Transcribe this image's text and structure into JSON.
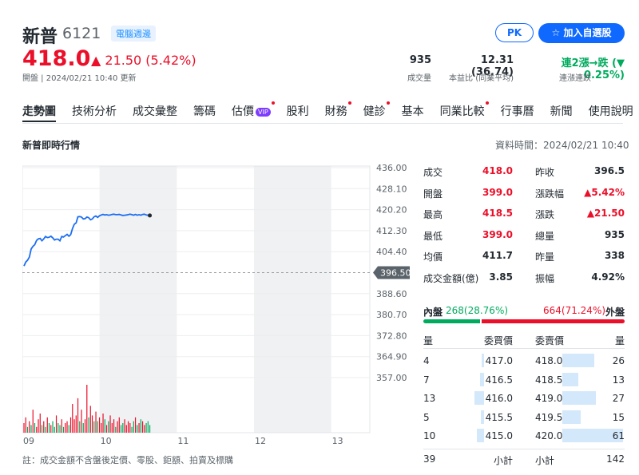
{
  "header": {
    "name": "新普",
    "code": "6121",
    "tag": "電腦週邊",
    "pk_label": "PK",
    "watch_label": "加入自選股",
    "price": "418.0",
    "change": "▲ 21.50 (5.42%)",
    "status": "開盤 | 2024/02/21 10:40 更新",
    "stats": [
      {
        "value": "935",
        "label": "成交量"
      },
      {
        "value": "12.31 (36.74)",
        "label": "本益比 (同業平均)"
      },
      {
        "value": "連2漲→跌 (▼ 0.25%)",
        "label": "連漲連跌"
      }
    ]
  },
  "tabs": [
    {
      "label": "走勢圖",
      "active": true,
      "dot": false
    },
    {
      "label": "技術分析",
      "active": false,
      "dot": false
    },
    {
      "label": "成交彙整",
      "active": false,
      "dot": false
    },
    {
      "label": "籌碼",
      "active": false,
      "dot": false
    },
    {
      "label": "估價",
      "active": false,
      "dot": true,
      "vip": "VIP"
    },
    {
      "label": "股利",
      "active": false,
      "dot": false
    },
    {
      "label": "財務",
      "active": false,
      "dot": true
    },
    {
      "label": "健診",
      "active": false,
      "dot": true
    },
    {
      "label": "基本",
      "active": false,
      "dot": false
    },
    {
      "label": "同業比較",
      "active": false,
      "dot": true
    },
    {
      "label": "行事曆",
      "active": false,
      "dot": false
    },
    {
      "label": "新聞",
      "active": false,
      "dot": false
    },
    {
      "label": "使用說明",
      "active": false,
      "dot": false
    }
  ],
  "section": {
    "title": "新普即時行情",
    "data_time": "資料時間：2024/02/21 10:40"
  },
  "colors": {
    "up": "#eb0f29",
    "down": "#00ab5e",
    "line": "#1c6ef2",
    "accent": "#0f69ff"
  },
  "chart_data": {
    "type": "line",
    "x_ticks": [
      "09",
      "10",
      "11",
      "12",
      "13"
    ],
    "y_ticks": [
      "436.00",
      "428.10",
      "420.20",
      "412.30",
      "404.40",
      "396.50",
      "388.60",
      "380.70",
      "372.80",
      "364.90",
      "357.00"
    ],
    "ylim": [
      357.0,
      436.0
    ],
    "reference_price": "396.50",
    "price_x": [
      0,
      1,
      2,
      3,
      4,
      5,
      6,
      7,
      8,
      9,
      10,
      11,
      12,
      13,
      14,
      15,
      16,
      17,
      18,
      19,
      20,
      21,
      22,
      23,
      24,
      25,
      26,
      27,
      28,
      29,
      30,
      31,
      32,
      33,
      34,
      35,
      36,
      37,
      38,
      39,
      40,
      41,
      42,
      43,
      44,
      45,
      46,
      47,
      48,
      49,
      50,
      51,
      52,
      53,
      54,
      55,
      56,
      57,
      58,
      59,
      60,
      61,
      62,
      63,
      64,
      65,
      66,
      67,
      68,
      69,
      70
    ],
    "price_values": [
      399.0,
      400.5,
      401.2,
      402.4,
      405.4,
      406.4,
      407.0,
      408.6,
      409.2,
      409.4,
      408.5,
      409.2,
      410.1,
      409.7,
      409.8,
      410.2,
      409.6,
      408.8,
      409.1,
      409.1,
      408.5,
      410.1,
      409.9,
      410.4,
      410.9,
      410.2,
      410.8,
      413.1,
      414.7,
      415.2,
      417.5,
      417.6,
      417.4,
      416.7,
      416.8,
      417.4,
      417.2,
      416.4,
      416.7,
      417.5,
      417.8,
      417.3,
      417.9,
      418.2,
      418.4,
      418.2,
      418.3,
      418.1,
      418.2,
      418.4,
      418.5,
      418.3,
      418.3,
      418.4,
      418.2,
      418.0,
      418.1,
      418.2,
      418.3,
      418.5,
      418.3,
      418.1,
      418.4,
      418.1,
      418.3,
      418.1,
      418.4,
      418.5,
      418.2,
      418.1,
      418.0
    ],
    "volume_values": [
      5,
      8,
      3,
      6,
      4,
      12,
      5,
      3,
      7,
      10,
      4,
      6,
      3,
      8,
      5,
      4,
      6,
      3,
      9,
      5,
      4,
      7,
      3,
      5,
      6,
      4,
      8,
      15,
      7,
      9,
      18,
      6,
      12,
      5,
      7,
      25,
      8,
      14,
      9,
      6,
      11,
      6,
      8,
      5,
      10,
      7,
      4,
      6,
      9,
      5,
      7,
      3,
      6,
      8,
      4,
      5,
      7,
      4,
      6,
      5,
      3,
      6,
      8,
      4,
      5,
      7,
      6,
      4,
      5,
      6,
      4
    ],
    "volume_colors": [
      "up",
      "up",
      "down",
      "up",
      "down",
      "up",
      "down",
      "up",
      "up",
      "up",
      "down",
      "up",
      "down",
      "up",
      "down",
      "up",
      "down",
      "down",
      "up",
      "down",
      "down",
      "up",
      "down",
      "up",
      "up",
      "down",
      "up",
      "up",
      "up",
      "up",
      "up",
      "down",
      "up",
      "down",
      "up",
      "up",
      "down",
      "up",
      "up",
      "down",
      "up",
      "down",
      "up",
      "up",
      "up",
      "down",
      "up",
      "down",
      "up",
      "up",
      "up",
      "down",
      "up",
      "up",
      "down",
      "down",
      "up",
      "up",
      "up",
      "up",
      "down",
      "down",
      "up",
      "down",
      "up",
      "down",
      "up",
      "up",
      "down",
      "down",
      "down"
    ]
  },
  "quote": {
    "left": [
      {
        "label": "成交",
        "value": "418.0",
        "color": "up"
      },
      {
        "label": "開盤",
        "value": "399.0",
        "color": "up"
      },
      {
        "label": "最高",
        "value": "418.5",
        "color": "up"
      },
      {
        "label": "最低",
        "value": "399.0",
        "color": "up"
      },
      {
        "label": "均價",
        "value": "411.7",
        "color": "flat"
      },
      {
        "label": "成交金額(億)",
        "value": "3.85",
        "color": "flat"
      }
    ],
    "right": [
      {
        "label": "昨收",
        "value": "396.5",
        "color": "flat"
      },
      {
        "label": "漲跌幅",
        "value": "▲5.42%",
        "color": "up"
      },
      {
        "label": "漲跌",
        "value": "▲21.50",
        "color": "up"
      },
      {
        "label": "總量",
        "value": "935",
        "color": "flat"
      },
      {
        "label": "昨量",
        "value": "338",
        "color": "flat"
      },
      {
        "label": "振幅",
        "value": "4.92%",
        "color": "flat"
      }
    ]
  },
  "inout": {
    "inner_label": "內盤",
    "inner_value": "268(28.76%)",
    "inner_fraction": 0.2876,
    "outer_value": "664(71.24%)",
    "outer_label": "外盤"
  },
  "orderbook": {
    "headers": [
      "量",
      "委買價",
      "委賣價",
      "量"
    ],
    "rows": [
      {
        "bid_vol": "4",
        "bid": "417.0",
        "ask": "418.0",
        "ask_vol": "26",
        "bid_frac": 0.05,
        "ask_frac": 0.52
      },
      {
        "bid_vol": "7",
        "bid": "416.5",
        "ask": "418.5",
        "ask_vol": "13",
        "bid_frac": 0.09,
        "ask_frac": 0.26
      },
      {
        "bid_vol": "13",
        "bid": "416.0",
        "ask": "419.0",
        "ask_vol": "27",
        "bid_frac": 0.2,
        "ask_frac": 0.55
      },
      {
        "bid_vol": "5",
        "bid": "415.5",
        "ask": "419.5",
        "ask_vol": "15",
        "bid_frac": 0.07,
        "ask_frac": 0.3
      },
      {
        "bid_vol": "10",
        "bid": "415.0",
        "ask": "420.0",
        "ask_vol": "61",
        "bid_frac": 0.15,
        "ask_frac": 1.0
      }
    ],
    "total_bid": "39",
    "total_bid_label": "小計",
    "total_ask_label": "小計",
    "total_ask": "142"
  },
  "note": "註：成交金額不含盤後定價、零股、鉅額、拍賣及標購"
}
